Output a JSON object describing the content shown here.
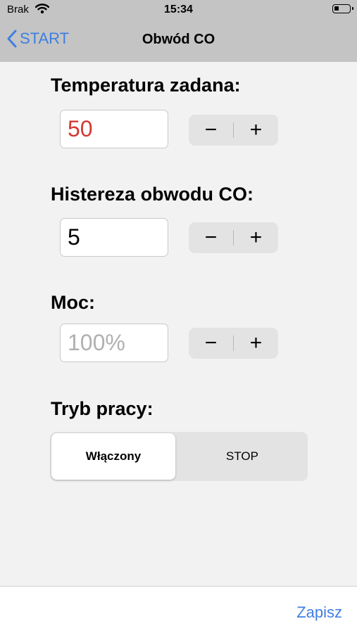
{
  "status": {
    "carrier": "Brak",
    "time": "15:34",
    "battery_level": 0.3
  },
  "nav": {
    "back_label": "START",
    "title": "Obwód CO"
  },
  "temperature": {
    "label": "Temperatura zadana:",
    "value": "50",
    "minus": "−",
    "plus": "+"
  },
  "hysteresis": {
    "label": "Histereza obwodu CO:",
    "value": "5",
    "minus": "−",
    "plus": "+"
  },
  "power": {
    "label": "Moc:",
    "placeholder": "100%",
    "minus": "−",
    "plus": "+"
  },
  "mode": {
    "label": "Tryb pracy:",
    "options": [
      "Włączony",
      "STOP"
    ],
    "selected": "Włączony"
  },
  "footer": {
    "save_label": "Zapisz"
  },
  "colors": {
    "accent": "#3f7ee0",
    "value_red": "#d13a32",
    "bar_gray": "#c4c4c4"
  },
  "icons": {
    "wifi": "wifi-icon",
    "battery": "battery-icon",
    "back": "chevron-left-icon"
  }
}
